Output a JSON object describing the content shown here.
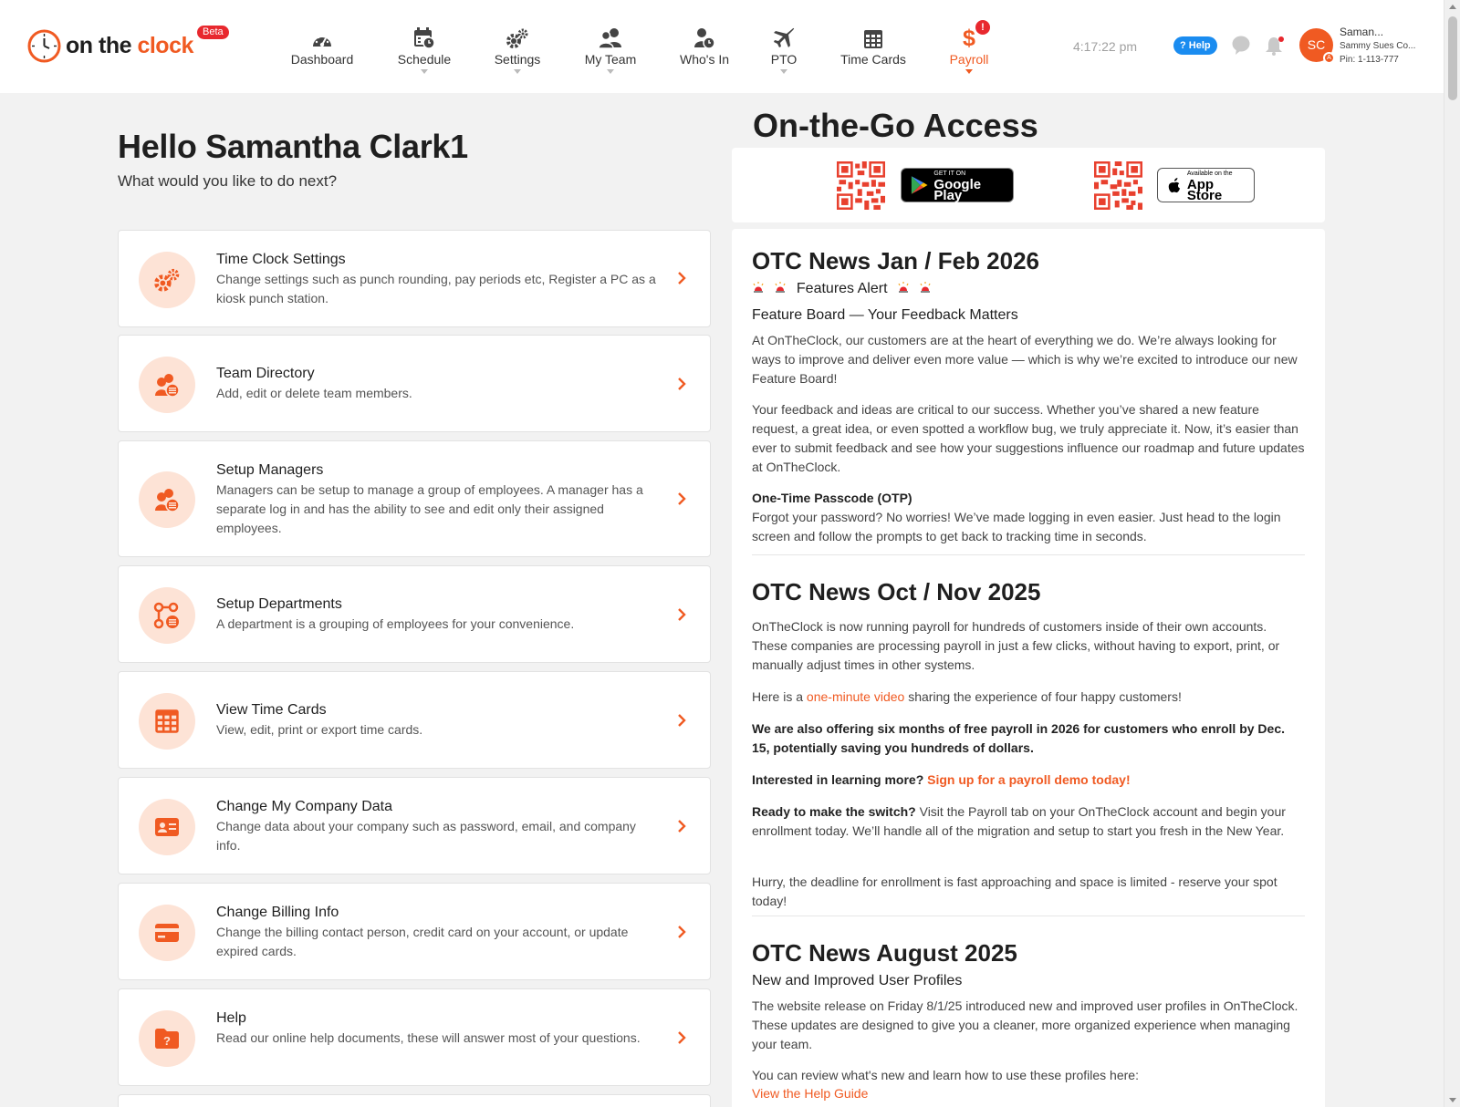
{
  "app": {
    "brand_part1": "on the",
    "brand_part2": "clock",
    "beta": "Beta",
    "accent_color": "#f05a22"
  },
  "nav": {
    "items": [
      {
        "label": "Dashboard",
        "icon": "dashboard-gauge-icon"
      },
      {
        "label": "Schedule",
        "icon": "calendar-clock-icon"
      },
      {
        "label": "Settings",
        "icon": "gears-icon"
      },
      {
        "label": "My Team",
        "icon": "team-icon"
      },
      {
        "label": "Who's In",
        "icon": "person-clock-icon"
      },
      {
        "label": "PTO",
        "icon": "airplane-icon"
      },
      {
        "label": "Time Cards",
        "icon": "table-grid-icon"
      },
      {
        "label": "Payroll",
        "icon": "dollar-icon",
        "badge": "!"
      }
    ],
    "time": "4:17:22 pm",
    "help": "? Help",
    "user": {
      "initials": "SC",
      "mini_initial": "A",
      "name": "Saman...",
      "company": "Sammy Sues Co...",
      "pin": "Pin: 1-113-777"
    }
  },
  "main": {
    "hello": "Hello Samantha Clark1",
    "subtitle": "What would you like to do next?",
    "cards": [
      {
        "title": "Time Clock Settings",
        "desc": "Change settings such as punch rounding, pay periods etc, Register a PC as a kiosk punch station.",
        "icon": "gears-icon"
      },
      {
        "title": "Team Directory",
        "desc": "Add, edit or delete team members.",
        "icon": "team-directory-icon"
      },
      {
        "title": "Setup Managers",
        "desc": "Managers can be setup to manage a group of employees. A manager has a separate log in and has the ability to see and edit only their assigned employees.",
        "icon": "managers-icon"
      },
      {
        "title": "Setup Departments",
        "desc": "A department is a grouping of employees for your convenience.",
        "icon": "departments-icon"
      },
      {
        "title": "View Time Cards",
        "desc": "View, edit, print or export time cards.",
        "icon": "time-cards-icon"
      },
      {
        "title": "Change My Company Data",
        "desc": "Change data about your company such as password, email, and company info.",
        "icon": "id-card-icon"
      },
      {
        "title": "Change Billing Info",
        "desc": "Change the billing contact person, credit card on your account, or update expired cards.",
        "icon": "credit-card-icon"
      },
      {
        "title": "Help",
        "desc": "Read our online help documents, these will answer most of your questions.",
        "icon": "help-folder-icon"
      }
    ]
  },
  "otg": {
    "title": "On-the-Go Access",
    "google_small": "GET IT ON",
    "google_big": "Google Play",
    "apple_small": "Available on the",
    "apple_big": "App Store"
  },
  "news": {
    "n1_title": "OTC News Jan / Feb 2026",
    "n1_alert": "Features Alert",
    "n1_sub": "Feature Board — Your Feedback Matters",
    "n1_p1": "At OnTheClock, our customers are at the heart of everything we do. We’re always looking for ways to improve and deliver even more value — which is why we’re excited to introduce our new Feature Board!",
    "n1_p2": "Your feedback and ideas are critical to our success. Whether you’ve shared a new feature request, a great idea, or even spotted a workflow bug, we truly appreciate it. Now, it’s easier than ever to submit feedback and see how your suggestions influence our roadmap and future updates at OnTheClock.",
    "n1_otp_title": "One-Time Passcode (OTP)",
    "n1_otp": "Forgot your password? No worries! We’ve made logging in even easier. Just head to the login screen and follow the prompts to get back to tracking time in seconds.",
    "n2_title": "OTC News Oct / Nov 2025",
    "n2_p1": "OnTheClock is now running payroll for hundreds of customers inside of their own accounts. These companies are processing payroll in just a few clicks, without having to export, print, or manually adjust times in other systems.",
    "n2_p2_pre": "Here is a ",
    "n2_p2_link": "one-minute video",
    "n2_p2_post": " sharing the experience of four happy customers!",
    "n2_p3": "We are also offering six months of free payroll in 2026 for customers who enroll by Dec. 15, potentially saving you hundreds of dollars.",
    "n2_p4_pre": "Interested in learning more? ",
    "n2_p4_link": "Sign up for a payroll demo today!",
    "n2_p5_bold": "Ready to make the switch?",
    "n2_p5": " Visit the Payroll tab on your OnTheClock account and begin your enrollment today. We’ll handle all of the migration and setup to start you fresh in the New Year.",
    "n2_p6": "Hurry, the deadline for enrollment is fast approaching and space is limited - reserve your spot today!",
    "n3_title": "OTC News August 2025",
    "n3_sub": "New and Improved User Profiles",
    "n3_p1": "The website release on Friday 8/1/25 introduced new and improved user profiles in OnTheClock. These updates are designed to give you a cleaner, more organized experience when managing your team.",
    "n3_p2": "You can review what's new and learn how to use these profiles here:",
    "n3_link": "View the Help Guide"
  }
}
